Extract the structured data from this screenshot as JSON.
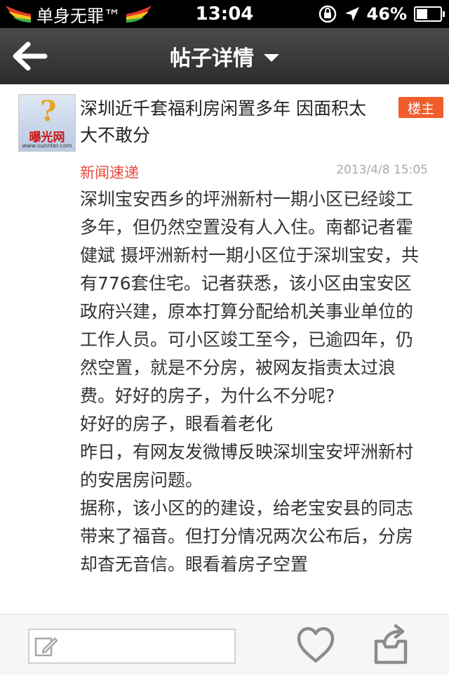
{
  "status_bar": {
    "carrier": "单身无罪™",
    "time": "13:04",
    "battery": "46%",
    "battery_level": 0.46
  },
  "navbar": {
    "title": "帖子详情"
  },
  "post": {
    "avatar_brand": "曝光网",
    "avatar_url": "www.sunnter.com",
    "title": "深圳近千套福利房闲置多年 因面积太大不敢分",
    "op_badge": "楼主",
    "category": "新闻速递",
    "timestamp": "2013/4/8 15:05",
    "paragraphs": [
      "深圳宝安西乡的坪洲新村一期小区已经竣工多年，但仍然空置没有人入住。南都记者霍健斌 摄坪洲新村一期小区位于深圳宝安，共有776套住宅。记者获悉，该小区由宝安区政府兴建，原本打算分配给机关事业单位的工作人员。可小区竣工至今，已逾四年，仍然空置，就是不分房，被网友指责太过浪费。好好的房子，为什么不分呢?",
      "好好的房子，眼看着老化",
      "昨日，有网友发微博反映深圳宝安坪洲新村的安居房问题。",
      "据称，该小区的的建设，给老宝安县的同志带来了福音。但打分情况两次公布后，分房却杳无音信。眼看着房子空置"
    ]
  },
  "bottom_bar": {
    "comment_value": ""
  },
  "colors": {
    "accent": "#f05d2b",
    "category": "#e84a3c",
    "navbar": "#3a3a3a"
  }
}
